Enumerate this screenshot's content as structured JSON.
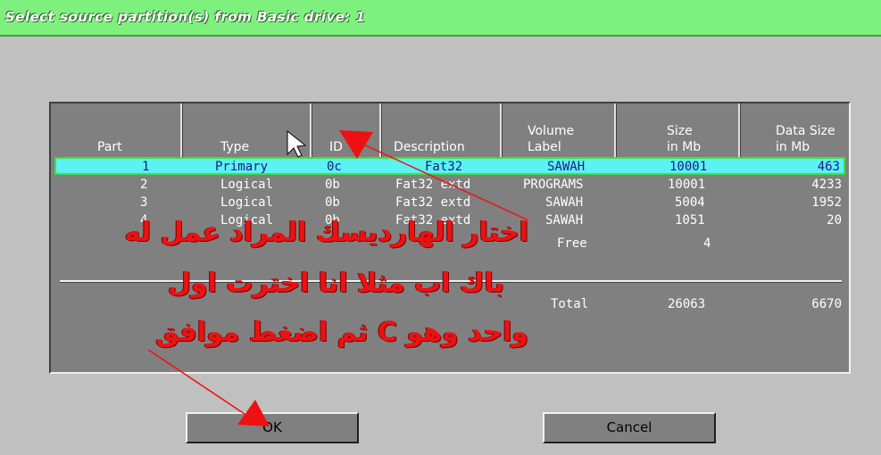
{
  "title": "Select source partition(s) from Basic drive: 1",
  "columns": [
    {
      "label": "Part",
      "label2": ""
    },
    {
      "label": "Type",
      "label2": ""
    },
    {
      "label": "ID",
      "label2": ""
    },
    {
      "label": "Description",
      "label2": ""
    },
    {
      "label": "Volume",
      "label2": "Label"
    },
    {
      "label": "Size",
      "label2": "in Mb"
    },
    {
      "label": "Data Size",
      "label2": "in Mb"
    }
  ],
  "rows": [
    {
      "part": "1",
      "type": "Primary",
      "id": "0c",
      "description": "Fat32",
      "label": "SAWAH",
      "size": "10001",
      "data_size": "463",
      "selected": true
    },
    {
      "part": "2",
      "type": "Logical",
      "id": "0b",
      "description": "Fat32 extd",
      "label": "PROGRAMS",
      "size": "10001",
      "data_size": "4233",
      "selected": false
    },
    {
      "part": "3",
      "type": "Logical",
      "id": "0b",
      "description": "Fat32 extd",
      "label": "SAWAH",
      "size": "5004",
      "data_size": "1952",
      "selected": false
    },
    {
      "part": "4",
      "type": "Logical",
      "id": "0b",
      "description": "Fat32 extd",
      "label": "SAWAH",
      "size": "1051",
      "data_size": "20",
      "selected": false
    }
  ],
  "free_row": {
    "label": "Free",
    "size": "4"
  },
  "total_row": {
    "label": "Total",
    "size": "26063",
    "data_size": "6670"
  },
  "buttons": {
    "ok": "OK",
    "cancel": "Cancel"
  },
  "annotation": {
    "line1": "اختار الهارديسك المراد عمل له",
    "line2": "باك اب مثلا انا اخترت اول",
    "line3": "واحد وهو C ثم اضغط موافق",
    "color": "#ee1111"
  },
  "colors": {
    "title_bar": "#7ef07e",
    "selection": "#5cf2f2",
    "table_bg": "#808080"
  }
}
